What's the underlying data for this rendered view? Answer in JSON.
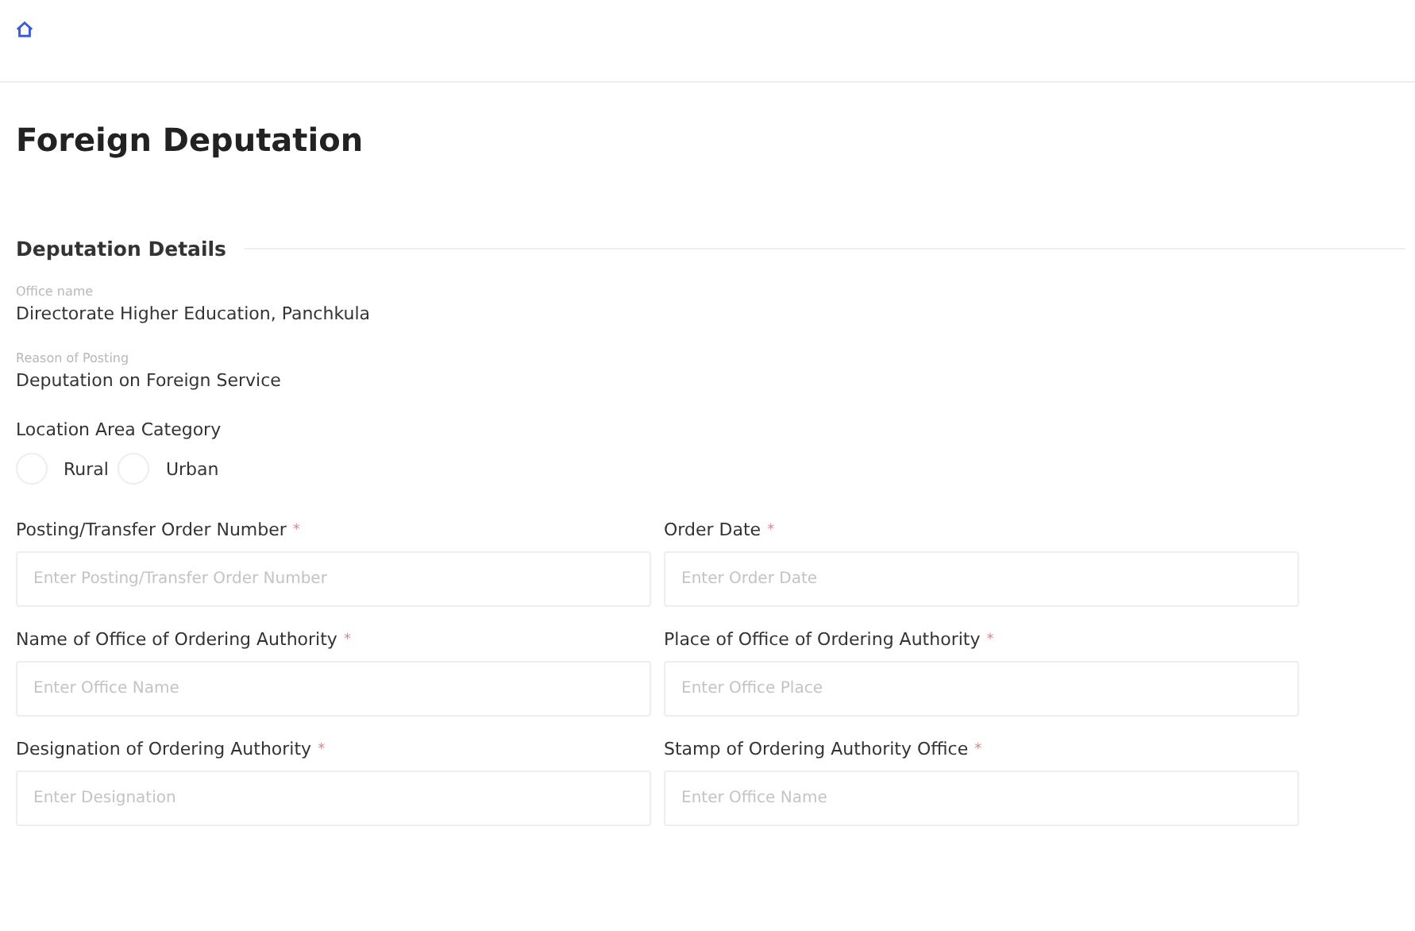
{
  "page_title": "Foreign Deputation",
  "section_title": "Deputation Details",
  "info": [
    {
      "label": "Office name",
      "value": "Directorate Higher Education, Panchkula"
    },
    {
      "label": "Reason of Posting",
      "value": "Deputation on Foreign Service"
    }
  ],
  "location_area": {
    "label": "Location Area Category",
    "options": [
      {
        "label": "Rural",
        "selected": false
      },
      {
        "label": "Urban",
        "selected": false
      }
    ]
  },
  "fields": [
    {
      "label": "Posting/Transfer Order Number",
      "required_mark": "*",
      "placeholder": "Enter Posting/Transfer Order Number"
    },
    {
      "label": "Order Date",
      "required_mark": "*",
      "placeholder": "Enter Order Date"
    },
    {
      "label": "Name of Office of Ordering Authority",
      "required_mark": "*",
      "placeholder": "Enter Office Name"
    },
    {
      "label": "Place of Office of Ordering Authority",
      "required_mark": "*",
      "placeholder": "Enter Office Place"
    },
    {
      "label": "Designation of Ordering Authority",
      "required_mark": "*",
      "placeholder": "Enter Designation"
    },
    {
      "label": "Stamp of Ordering Authority Office",
      "required_mark": "*",
      "placeholder": "Enter Office Name"
    }
  ]
}
